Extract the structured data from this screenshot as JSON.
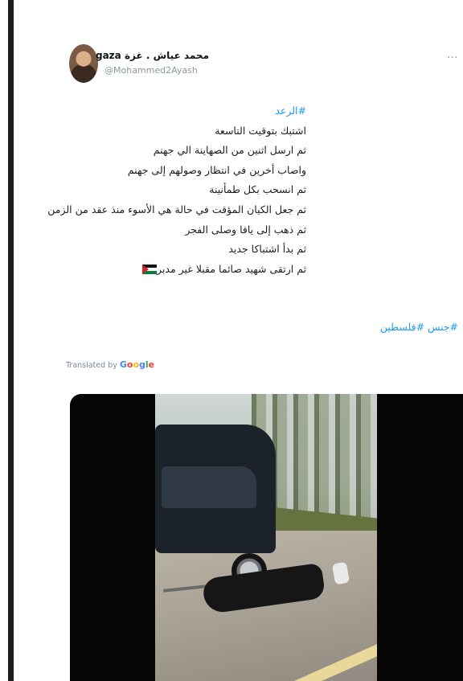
{
  "author": {
    "display_name": "محمد عياش . غزة gaza",
    "handle": "@Mohammed2Ayash",
    "avatar_icon": "profile-photo"
  },
  "more_label": "···",
  "tweet": {
    "lines": [
      "#الرعد",
      "اشتبك بتوقيت التاسعة",
      "ثم ارسل اثنين من الصهاينة الي جهنم",
      "واصاب أخرين في انتظار وصولهم إلى جهنم",
      "ثم انسحب بكل طمأنينة",
      "ثم جعل الكيان المؤقت في حالة هي الأسوء منذ عقد من الزمن",
      "ثم ذهب إلى يافا وصلى الفجر",
      "ثم بدأ اشتباكا جديد",
      "ثم ارتقى شهيد صائما مقبلا غير مدبر"
    ],
    "hashtags": "#جنس #فلسطين",
    "flag_icon": "palestine-flag",
    "flag_colors": [
      "#111111",
      "#ffffff",
      "#0b7a3b",
      "#d4232d"
    ]
  },
  "translated_by": {
    "prefix": "Translated by ",
    "brand": "Google"
  },
  "media": {
    "type": "video-thumbnail",
    "letterbox_color": "#060606"
  },
  "accent_color": "#1d9bf0"
}
